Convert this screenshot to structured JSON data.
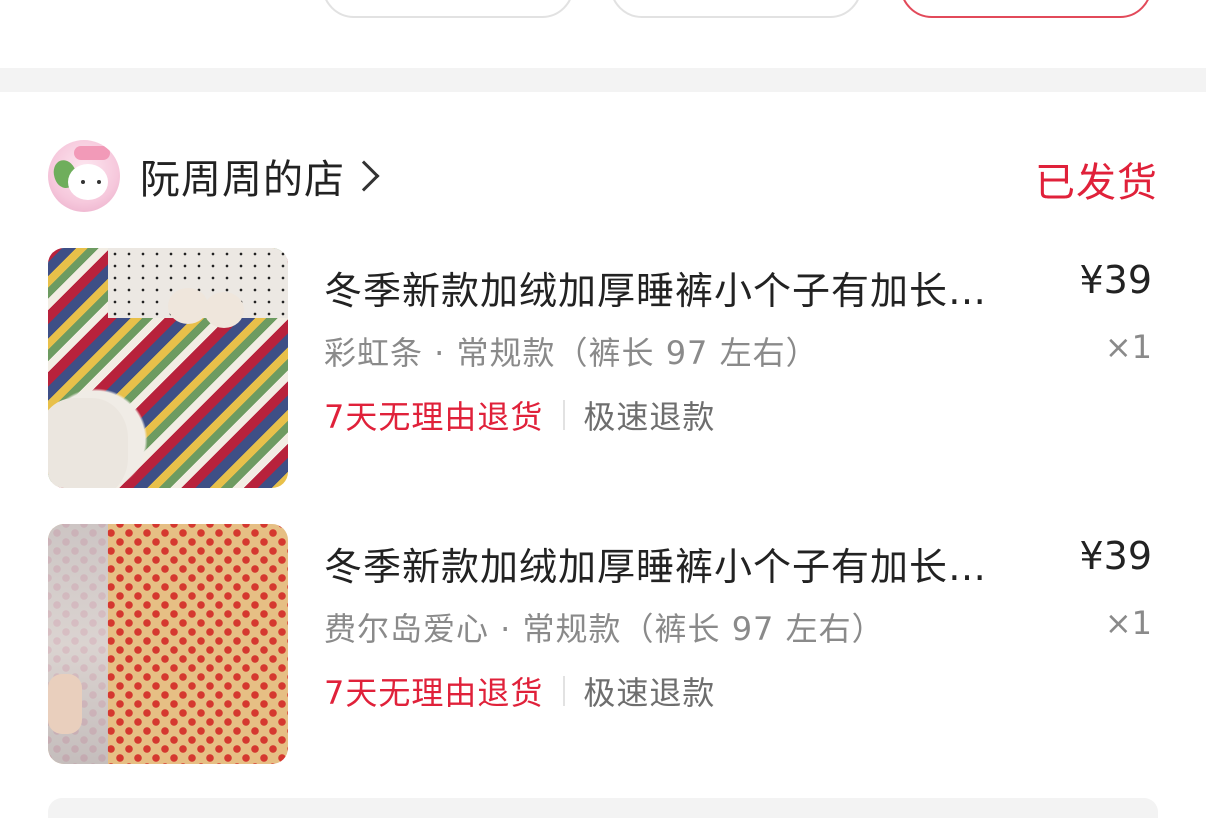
{
  "top_buttons": [
    {
      "label": ""
    },
    {
      "label": ""
    },
    {
      "label": ""
    }
  ],
  "shop": {
    "name": "阮周周的店",
    "status": "已发货"
  },
  "items": [
    {
      "title": "冬季新款加绒加厚睡裤小个子有加长…",
      "price": "¥39",
      "spec": "彩虹条 · 常规款（裤长 97 左右）",
      "quantity": "×1",
      "tag_return": "7天无理由退货",
      "tag_refund": "极速退款"
    },
    {
      "title": "冬季新款加绒加厚睡裤小个子有加长…",
      "price": "¥39",
      "spec": "费尔岛爱心 · 常规款（裤长 97 左右）",
      "quantity": "×1",
      "tag_return": "7天无理由退货",
      "tag_refund": "极速退款"
    }
  ],
  "colors": {
    "accent": "#e0213a",
    "secondary_text": "#8a8a8a",
    "band": "#f3f3f3"
  },
  "icons": {
    "shop_chevron": "chevron-right-icon"
  }
}
